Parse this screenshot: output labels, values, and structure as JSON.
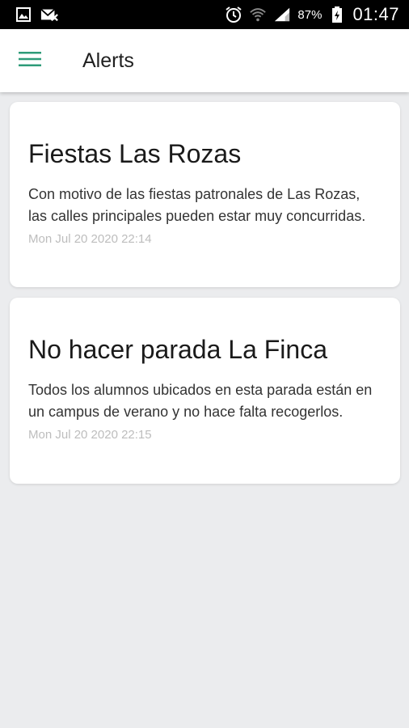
{
  "status_bar": {
    "battery_percent": "87%",
    "time": "01:47",
    "icons": [
      "gallery-icon",
      "mail-x-icon",
      "alarm-icon",
      "wifi-icon",
      "signal-icon",
      "battery-icon"
    ]
  },
  "app_bar": {
    "title": "Alerts",
    "menu_icon": "hamburger-menu-icon",
    "accent_color": "#2e9b79"
  },
  "alerts": [
    {
      "title": "Fiestas Las Rozas",
      "body": "Con motivo de las fiestas patronales de Las Rozas, las calles principales pueden estar muy concurridas.",
      "date": "Mon Jul 20 2020 22:14"
    },
    {
      "title": "No hacer parada La Finca",
      "body": "Todos los alumnos ubicados en esta parada están en un campus de verano y no hace falta recogerlos.",
      "date": "Mon Jul 20 2020 22:15"
    }
  ]
}
